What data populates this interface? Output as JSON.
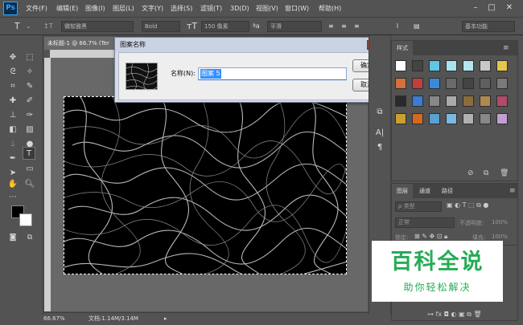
{
  "app": {
    "logo": "Ps"
  },
  "menu": [
    "文件(F)",
    "编辑(E)",
    "图像(I)",
    "图层(L)",
    "文字(Y)",
    "选择(S)",
    "滤镜(T)",
    "3D(D)",
    "视图(V)",
    "窗口(W)",
    "帮助(H)"
  ],
  "window_controls": {
    "minimize": "–",
    "maximize": "□",
    "close": "✕"
  },
  "options_bar": {
    "tool_glyph": "T",
    "font_family": "微软雅黑",
    "font_style": "Bold",
    "font_size": "150 像素",
    "antialias": "平滑",
    "workspace": "基本功能",
    "text_color": "#000000"
  },
  "document": {
    "tab_title": "未标题-1 @ 66.7% (Ter",
    "zoom": "66.67%",
    "doc_size": "文档:1.14M/3.14M"
  },
  "dialog": {
    "title": "图案名称",
    "name_label": "名称(N):",
    "name_value": "图案 5",
    "ok_label": "确定",
    "cancel_label": "取消",
    "close_glyph": "✕"
  },
  "styles_panel": {
    "tab": "样式",
    "swatch_colors": [
      "#ffffff",
      "#444444",
      "#5fc6e6",
      "#a8e4f0",
      "#b4e6f0",
      "#c8c8c8",
      "#e3c64a",
      "#d66f3a",
      "#c04040",
      "#3c8ad6",
      "#6a6a6a",
      "#444444",
      "#5f5f5f",
      "#7a7a7a",
      "#2a2a2a",
      "#3a7bd5",
      "#888888",
      "#aaaaaa",
      "#8a6d3b",
      "#b08850",
      "#b34a6a",
      "#c8a030",
      "#d06a20",
      "#5aa0d0",
      "#7ab8e0",
      "#b0b0b0",
      "#888888",
      "#c0a0d0"
    ]
  },
  "layers_panel": {
    "tabs": [
      "图层",
      "通道",
      "路径"
    ],
    "filter_label": "ρ 类型",
    "blend_mode": "正常",
    "opacity_label": "不透明度:",
    "opacity_value": "100%",
    "lock_label": "锁定:",
    "fill_label": "填充:",
    "fill_value": "100%"
  },
  "watermark": {
    "title": "百科全说",
    "subtitle": "助你轻松解决"
  }
}
